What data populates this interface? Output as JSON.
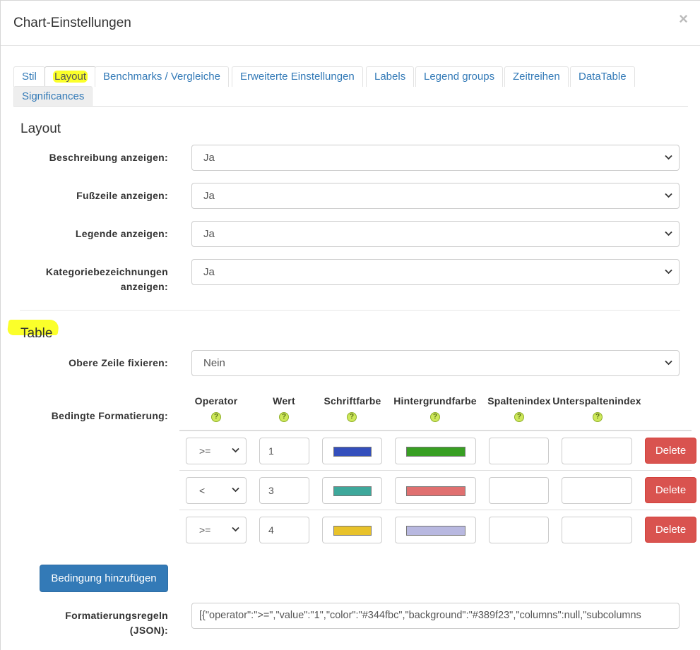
{
  "modal": {
    "title": "Chart-Einstellungen",
    "close": "×"
  },
  "tabs": [
    {
      "label": "Stil"
    },
    {
      "label": "Layout"
    },
    {
      "label": "Benchmarks / Vergleiche"
    },
    {
      "label": "Erweiterte Einstellungen"
    },
    {
      "label": "Labels"
    },
    {
      "label": "Legend groups"
    },
    {
      "label": "Zeitreihen"
    },
    {
      "label": "DataTable"
    },
    {
      "label": "Significances"
    }
  ],
  "layout_section": {
    "title": "Layout",
    "fields": [
      {
        "label": "Beschreibung anzeigen:",
        "value": "Ja"
      },
      {
        "label": "Fußzeile anzeigen:",
        "value": "Ja"
      },
      {
        "label": "Legende anzeigen:",
        "value": "Ja"
      },
      {
        "label_line1": "Kategoriebezeichnungen",
        "label_line2": "anzeigen:",
        "value": "Ja"
      }
    ]
  },
  "table_section": {
    "title": "Table",
    "freeze": {
      "label": "Obere Zeile fixieren:",
      "value": "Nein"
    },
    "conditional": {
      "label": "Bedingte Formatierung:",
      "columns": [
        "Operator",
        "Wert",
        "Schriftfarbe",
        "Hintergrundfarbe",
        "Spaltenindex",
        "Unterspaltenindex"
      ],
      "help_glyph": "?",
      "rows": [
        {
          "operator": ">=",
          "value": "1",
          "font_color": "#344fbc",
          "background": "#389f23",
          "column": "",
          "subcolumn": "",
          "delete": "Delete"
        },
        {
          "operator": "<",
          "value": "3",
          "font_color": "#3ea89b",
          "background": "#e07070",
          "column": "",
          "subcolumn": "",
          "delete": "Delete"
        },
        {
          "operator": ">=",
          "value": "4",
          "font_color": "#e8c22a",
          "background": "#b8b8e0",
          "column": "",
          "subcolumn": "",
          "delete": "Delete"
        }
      ],
      "add_button": "Bedingung hinzufügen"
    },
    "json_rules": {
      "label_line1": "Formatierungsregeln",
      "label_line2": "(JSON):",
      "value": "[{\"operator\":\">=\",\"value\":\"1\",\"color\":\"#344fbc\",\"background\":\"#389f23\",\"columns\":null,\"subcolumns"
    }
  },
  "colors": {
    "link": "#337ab7",
    "danger": "#d9534f",
    "primary": "#337ab7",
    "highlight": "#fbff2a"
  }
}
